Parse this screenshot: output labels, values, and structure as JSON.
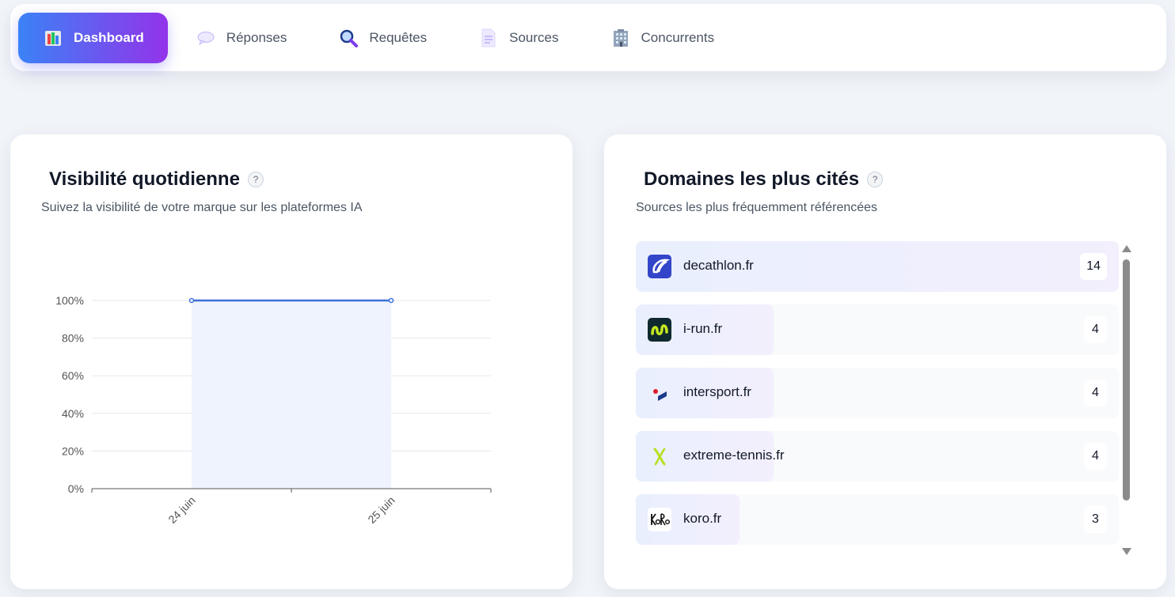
{
  "nav": {
    "tabs": [
      {
        "label": "Dashboard",
        "icon": "bar-chart-icon",
        "active": true
      },
      {
        "label": "Réponses",
        "icon": "speech-bubble-icon",
        "active": false
      },
      {
        "label": "Requêtes",
        "icon": "magnifier-icon",
        "active": false
      },
      {
        "label": "Sources",
        "icon": "document-icon",
        "active": false
      },
      {
        "label": "Concurrents",
        "icon": "building-icon",
        "active": false
      }
    ]
  },
  "visibility": {
    "title": "Visibilité quotidienne",
    "help": "?",
    "subtitle": "Suivez la visibilité de votre marque sur les plateformes IA"
  },
  "chart_data": {
    "type": "area",
    "title": "",
    "xlabel": "",
    "ylabel": "",
    "categories": [
      "24 juin",
      "25 juin"
    ],
    "series": [
      {
        "values": [
          100,
          100
        ]
      }
    ],
    "ylim": [
      0,
      100
    ],
    "yticks": [
      "0%",
      "20%",
      "40%",
      "60%",
      "80%",
      "100%"
    ],
    "ytick_values": [
      0,
      20,
      40,
      60,
      80,
      100
    ],
    "grid": true,
    "line_color": "#3b6fd8",
    "fill_color": "#eef3fd"
  },
  "domains": {
    "title": "Domaines les plus cités",
    "help": "?",
    "subtitle": "Sources les plus fréquemment référencées",
    "max": 14,
    "items": [
      {
        "name": "decathlon.fr",
        "count": 14,
        "icon": "decathlon-logo-icon"
      },
      {
        "name": "i-run.fr",
        "count": 4,
        "icon": "i-run-logo-icon"
      },
      {
        "name": "intersport.fr",
        "count": 4,
        "icon": "intersport-logo-icon"
      },
      {
        "name": "extreme-tennis.fr",
        "count": 4,
        "icon": "extreme-tennis-logo-icon"
      },
      {
        "name": "koro.fr",
        "count": 3,
        "icon": "koro-logo-icon"
      }
    ]
  }
}
